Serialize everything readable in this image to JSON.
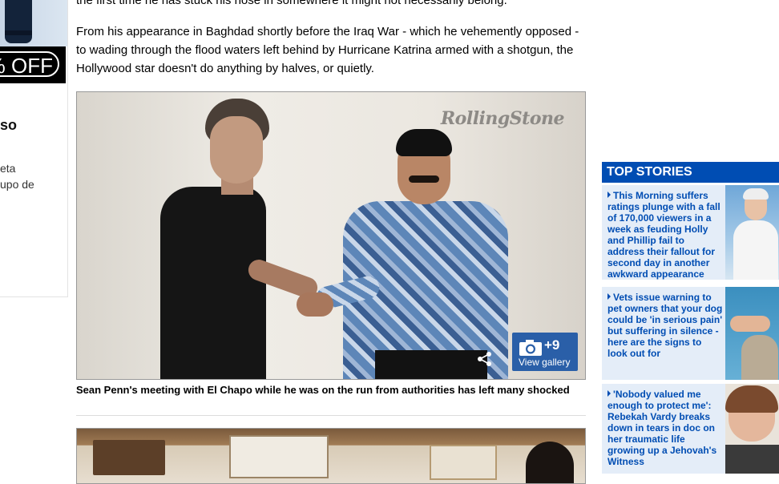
{
  "left_rail": {
    "promo_badge": "% OFF",
    "heading": "so",
    "text_lines": [
      "eta",
      "upo de"
    ]
  },
  "article": {
    "paragraph_1": "the first time he has stuck his nose in somewhere it might not necessarily belong.",
    "paragraph_2": "From his appearance in Baghdad shortly before the Iraq War - which he vehemently opposed - to wading through the flood waters left behind by Hurricane Katrina armed with a shotgun, the Hollywood star doesn't do anything by halves, or quietly.",
    "figure_1": {
      "watermark": "RollingStone",
      "gallery_count": "+9",
      "gallery_label": "View gallery",
      "caption": "Sean Penn's meeting with El Chapo while he was on the run from authorities has left many shocked"
    }
  },
  "right_column": {
    "top_stories_label": "TOP STORIES",
    "stories": [
      {
        "headline": "This Morning suffers ratings plunge with a fall of 170,000 viewers in a week as feuding Holly and Phillip fail to address their fallout for second day in another awkward appearance"
      },
      {
        "headline": "Vets issue warning to pet owners that your dog could be 'in serious pain' but suffering in silence - here are the signs to look out for"
      },
      {
        "headline": "'Nobody valued me enough to protect me': Rebekah Vardy breaks down in tears in doc on her traumatic life growing up a Jehovah's Witness"
      }
    ]
  },
  "colors": {
    "brand_blue": "#004db3",
    "story_background": "#e4edf8",
    "gallery_button": "#2a5fa8"
  }
}
